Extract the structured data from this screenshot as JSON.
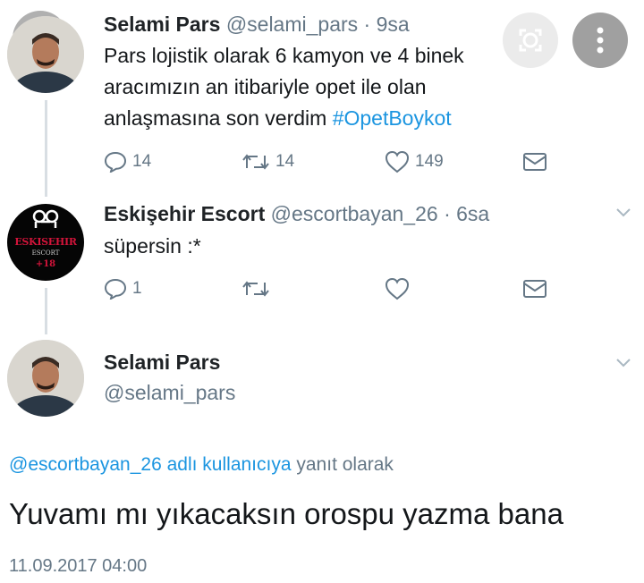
{
  "tweets": [
    {
      "name": "Selami Pars",
      "handle": "@selami_pars",
      "time": "9sa",
      "text_line1": "Pars lojistik olarak 6  kamyon ve 4 binek",
      "text_line2": "aracımızın an itibariyle opet ile olan",
      "text_line3": "anlaşmasına son verdim",
      "hashtag": "#OpetBoykot",
      "replies": "14",
      "retweets": "14",
      "likes": "149"
    },
    {
      "name": "Eskişehir Escort",
      "handle": "@escortbayan_26",
      "time": "6sa",
      "text": "süpersin :*",
      "replies": "1",
      "avatar_text_top": "ESKISEHIR",
      "avatar_text_mid": "ESCORT",
      "avatar_text_bottom": "+18"
    }
  ],
  "main_tweet": {
    "name": "Selami Pars",
    "handle": "@selami_pars",
    "reply_mention": "@escortbayan_26",
    "reply_to_suffix": "adlı kullanıcıya",
    "reply_to_word": "yanıt olarak",
    "text": "Yuvamı mı yıkacaksın orospu yazma bana",
    "timestamp": "11.09.2017 04:00"
  },
  "colors": {
    "link": "#1b95e0",
    "secondary_text": "#657786"
  },
  "icons": [
    "close-icon",
    "more-options-icon",
    "reply-icon",
    "retweet-icon",
    "like-icon",
    "direct-message-icon",
    "chevron-down-icon"
  ]
}
